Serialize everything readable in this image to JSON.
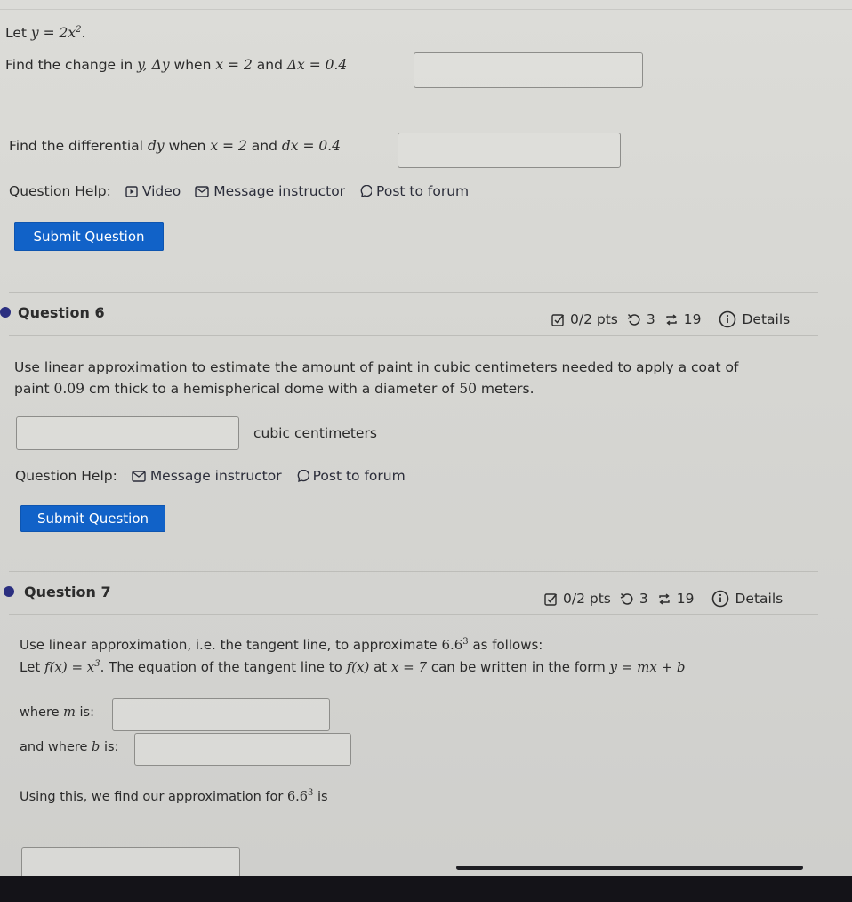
{
  "q5": {
    "intro_prefix": "Let",
    "intro_math": "y = 2x",
    "intro_exp": "2",
    "part1": {
      "prefix": "Find the change in",
      "var_y": "y,",
      "delta_y": "Δy",
      "when": "when",
      "x_eq": "x = 2",
      "and": "and",
      "dx_eq": "Δx = 0.4",
      "answer_value": ""
    },
    "part2": {
      "prefix": "Find the differential",
      "dy": "dy",
      "when": "when",
      "x_eq": "x = 2",
      "and": "and",
      "dx_eq": "dx = 0.4",
      "answer_value": ""
    },
    "help": {
      "label": "Question Help:",
      "video": "Video",
      "message": "Message instructor",
      "forum": "Post to forum"
    },
    "submit_label": "Submit Question"
  },
  "q6": {
    "title": "Question 6",
    "score": "0/2 pts",
    "retries": "3",
    "attempts": "19",
    "details": "Details",
    "body_line1": "Use linear approximation to estimate the amount of paint in cubic centimeters needed to apply a coat of",
    "body_line2_a": "paint",
    "body_line2_num1": "0.09",
    "body_line2_b": "cm thick to a hemispherical dome with a diameter of",
    "body_line2_num2": "50",
    "body_line2_c": "meters.",
    "answer_value": "",
    "unit_label": "cubic centimeters",
    "help": {
      "label": "Question Help:",
      "message": "Message instructor",
      "forum": "Post to forum"
    },
    "submit_label": "Submit Question"
  },
  "q7": {
    "title": "Question 7",
    "score": "0/2 pts",
    "retries": "3",
    "attempts": "19",
    "details": "Details",
    "line1_a": "Use linear approximation, i.e. the tangent line, to approximate",
    "line1_base": "6.6",
    "line1_exp": "3",
    "line1_b": "as follows:",
    "line2_a": "Let",
    "line2_fx": "f(x) = x",
    "line2_exp": "3",
    "line2_b": ". The equation of the tangent line to",
    "line2_fx2": "f(x)",
    "line2_c": "at",
    "line2_x": "x = 7",
    "line2_d": "can be written in the form",
    "line2_form": "y = mx + b",
    "m_label_a": "where",
    "m_label_var": "m",
    "m_label_b": "is:",
    "m_value": "",
    "b_label_a": "and where",
    "b_label_var": "b",
    "b_label_b": "is:",
    "b_value": "",
    "approx_a": "Using this, we find our approximation for",
    "approx_base": "6.6",
    "approx_exp": "3",
    "approx_b": "is",
    "approx_value": ""
  }
}
